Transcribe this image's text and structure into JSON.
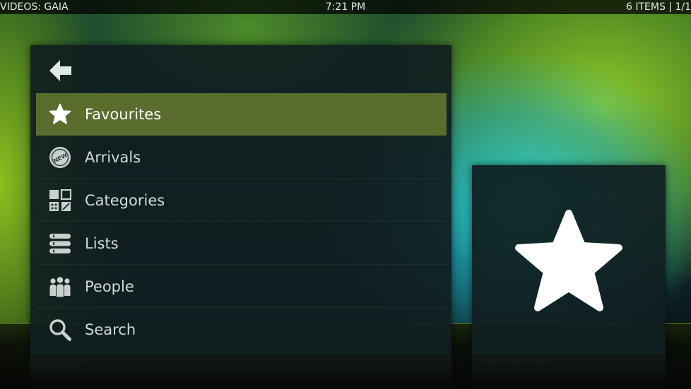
{
  "header": {
    "section": "VIDEOS: GAIA",
    "time": "7:21 PM",
    "item_count": "6 ITEMS | 1/1"
  },
  "menu": {
    "back_icon": "back-arrow-icon",
    "selected_index": 0,
    "items": [
      {
        "label": "Favourites",
        "icon": "star-icon"
      },
      {
        "label": "Arrivals",
        "icon": "new-badge-icon"
      },
      {
        "label": "Categories",
        "icon": "categories-grid-icon"
      },
      {
        "label": "Lists",
        "icon": "list-icon"
      },
      {
        "label": "People",
        "icon": "people-icon"
      },
      {
        "label": "Search",
        "icon": "search-icon"
      }
    ]
  },
  "preview": {
    "icon": "star-icon"
  },
  "colors": {
    "selected_highlight": "#5b6d2d",
    "panel": "#101e20",
    "text": "#d3dada"
  }
}
